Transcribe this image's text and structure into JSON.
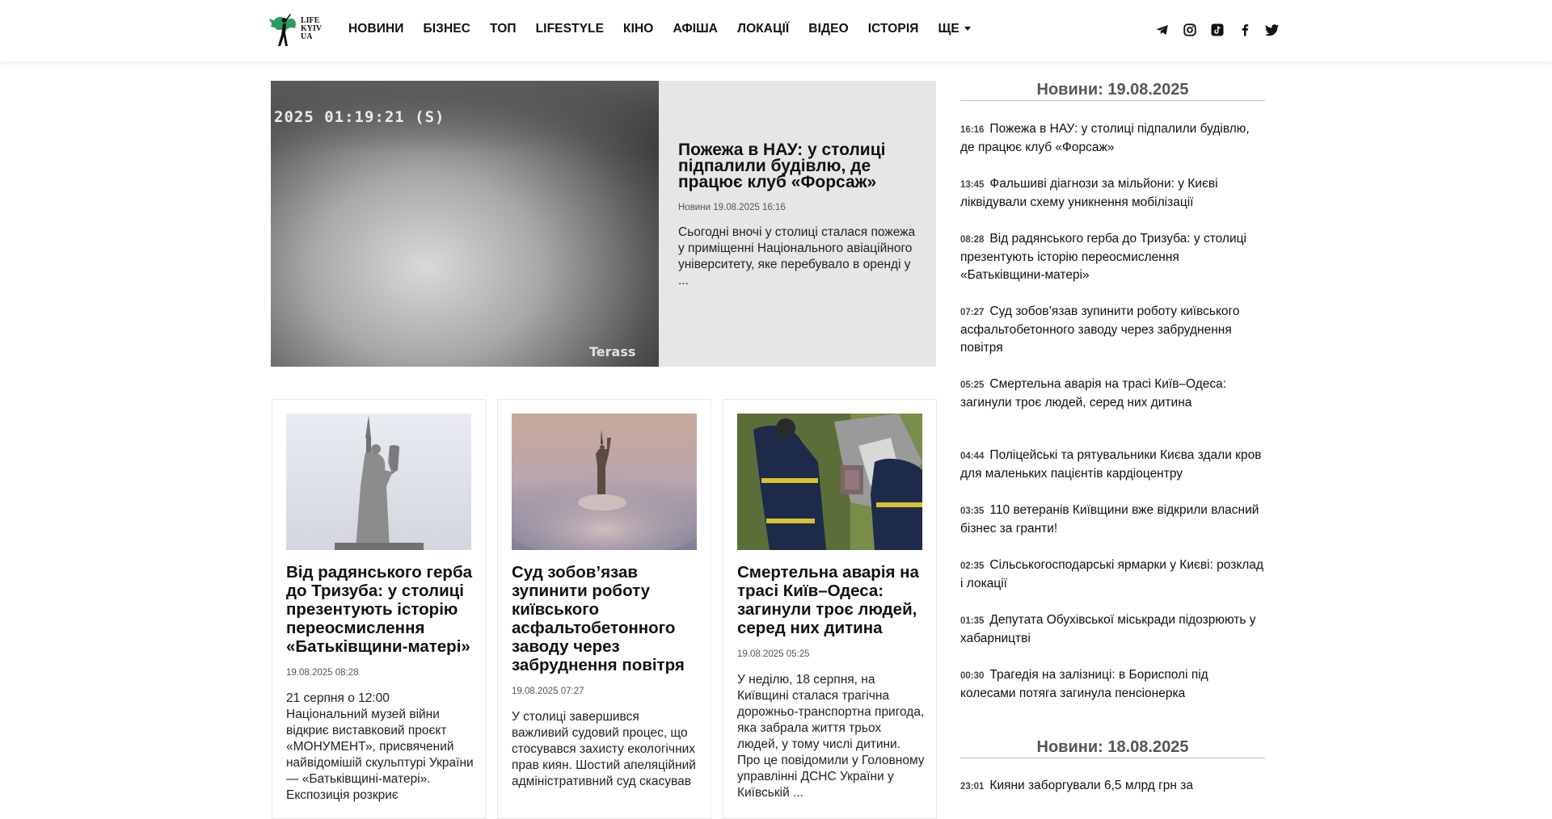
{
  "header": {
    "logo_lines": [
      "LIFE",
      "KYIV",
      "UA"
    ],
    "nav": [
      "НОВИНИ",
      "БІЗНЕС",
      "ТОП",
      "LIFESTYLE",
      "КІНО",
      "АФІША",
      "ЛОКАЦІЇ",
      "ВІДЕО",
      "ІСТОРІЯ",
      "ЩЕ"
    ],
    "social_icons": [
      "telegram-icon",
      "instagram-icon",
      "tiktok-icon",
      "facebook-icon",
      "twitter-icon"
    ]
  },
  "hero": {
    "image_stamp": "2025 01:19:21 (S)",
    "image_watermark": "Terass",
    "title": "Пожежа в НАУ: у столиці підпалили будівлю, де працює клуб «Форсаж»",
    "meta": "Новини 19.08.2025 16:16",
    "excerpt": "Сьогодні вночі у столиці сталася пожежа у приміщенні Національного авіаційного університету, яке перебувало в оренді у ..."
  },
  "cards": [
    {
      "title": "Від радянського герба до Тризуба: у столиці презентують історію переосмислення «Батьківщини-матері»",
      "date": "19.08.2025 08:28",
      "excerpt": "21 серпня о 12:00 Національний музей війни відкриє виставковий проєкт «МОНУМЕНТ», присвячений найвідомішій скульптурі України — «Батьківщині-матері». Експозиція розкриє"
    },
    {
      "title": "Суд зобов’язав зупинити роботу київського асфальтобетонного заводу через забруднення повітря",
      "date": "19.08.2025 07:27",
      "excerpt": "У столиці завершився важливий судовий процес, що стосувався захисту екологічних прав киян. Шостий апеляційний адміністративний суд скасував"
    },
    {
      "title": "Смертельна аварія на трасі Київ–Одеса: загинули троє людей, серед них дитина",
      "date": "19.08.2025 05:25",
      "excerpt": "У неділю, 18 серпня, на Київщині сталася трагічна дорожньо-транспортна пригода, яка забрала життя трьох людей, у тому числі дитини. Про це повідомили у Головному управлінні ДСНС України у Київській ..."
    }
  ],
  "sidebar": {
    "heading_1": "Новини: 19.08.2025",
    "items_1": [
      {
        "time": "16:16",
        "text": "Пожежа в НАУ: у столиці підпалили будівлю, де працює клуб «Форсаж»"
      },
      {
        "time": "13:45",
        "text": "Фальшиві діагнози за мільйони: у Києві ліквідували схему уникнення мобілізації"
      },
      {
        "time": "08:28",
        "text": "Від радянського герба до Тризуба: у столиці презентують історію переосмислення «Батьківщини-матері»"
      },
      {
        "time": "07:27",
        "text": "Суд зобов’язав зупинити роботу київського асфальтобетонного заводу через забруднення повітря"
      },
      {
        "time": "05:25",
        "text": "Смертельна аварія на трасі Київ–Одеса: загинули троє людей, серед них дитина"
      },
      {
        "time": "04:44",
        "text": "Поліцейські та рятувальники Києва здали кров для маленьких пацієнтів кардіоцентру"
      },
      {
        "time": "03:35",
        "text": "110 ветеранів Київщини вже відкрили власний бізнес за гранти!"
      },
      {
        "time": "02:35",
        "text": "Сільськогосподарські ярмарки у Києві: розклад і локації"
      },
      {
        "time": "01:35",
        "text": "Депутата Обухівської міськради підозрюють у хабарництві"
      },
      {
        "time": "00:30",
        "text": "Трагедія на залізниці: в Борисполі під колесами потяга загинула пенсіонерка"
      }
    ],
    "heading_2": "Новини: 18.08.2025",
    "items_2": [
      {
        "time": "23:01",
        "text": "Кияни заборгували 6,5 млрд грн за"
      }
    ]
  }
}
